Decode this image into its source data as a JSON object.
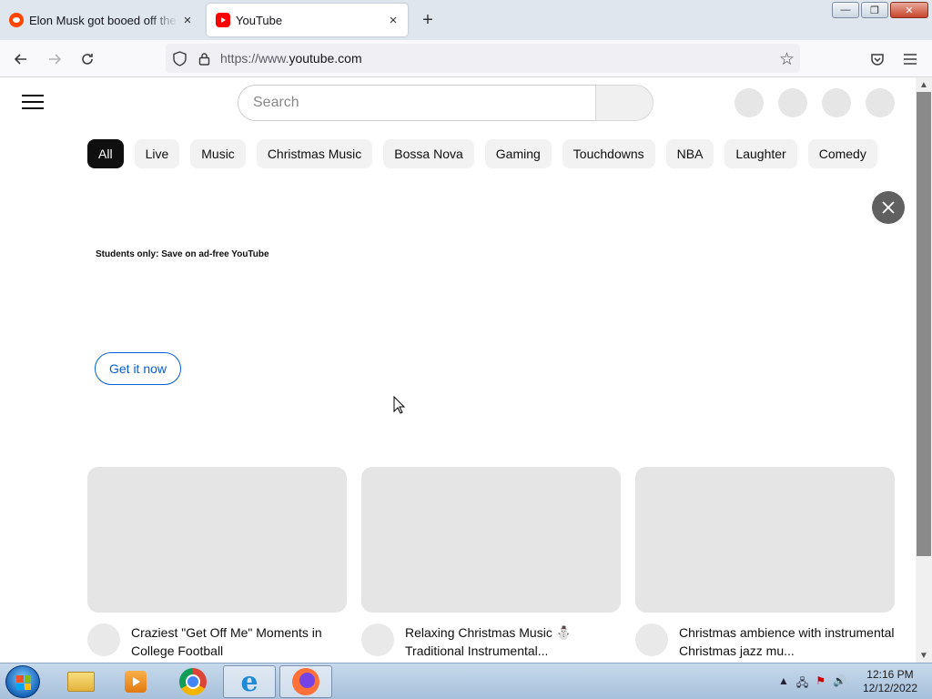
{
  "browser": {
    "tabs": [
      {
        "title": "Elon Musk got booed off the stage",
        "favicon": "reddit-icon",
        "close": "×"
      },
      {
        "title": "YouTube",
        "favicon": "youtube-icon",
        "close": "×"
      }
    ],
    "new_tab": "+",
    "url_prefix": "https://www.",
    "url_host": "youtube.com",
    "window_buttons": {
      "minimize": "—",
      "restore": "❐",
      "close": "✕"
    }
  },
  "youtube": {
    "search_placeholder": "Search",
    "chips": [
      "All",
      "Live",
      "Music",
      "Christmas Music",
      "Bossa Nova",
      "Gaming",
      "Touchdowns",
      "NBA",
      "Laughter",
      "Comedy"
    ],
    "ad": {
      "title": "Students only: Save on ad-free YouTube",
      "cta": "Get it now"
    },
    "videos": [
      {
        "title": "Craziest \"Get Off Me\" Moments in College Football"
      },
      {
        "title": "Relaxing Christmas Music ⛄ Traditional Instrumental..."
      },
      {
        "title": "Christmas ambience with instrumental Christmas jazz mu..."
      }
    ]
  },
  "taskbar": {
    "items": [
      "folder-icon",
      "media-player-icon",
      "chrome-icon",
      "internet-explorer-icon",
      "firefox-icon"
    ],
    "clock_time": "12:16 PM",
    "clock_date": "12/12/2022"
  },
  "colors": {
    "accent_blue": "#065fd4",
    "chip_active": "#0f0f0f",
    "placeholder_gray": "#e5e5e5"
  }
}
